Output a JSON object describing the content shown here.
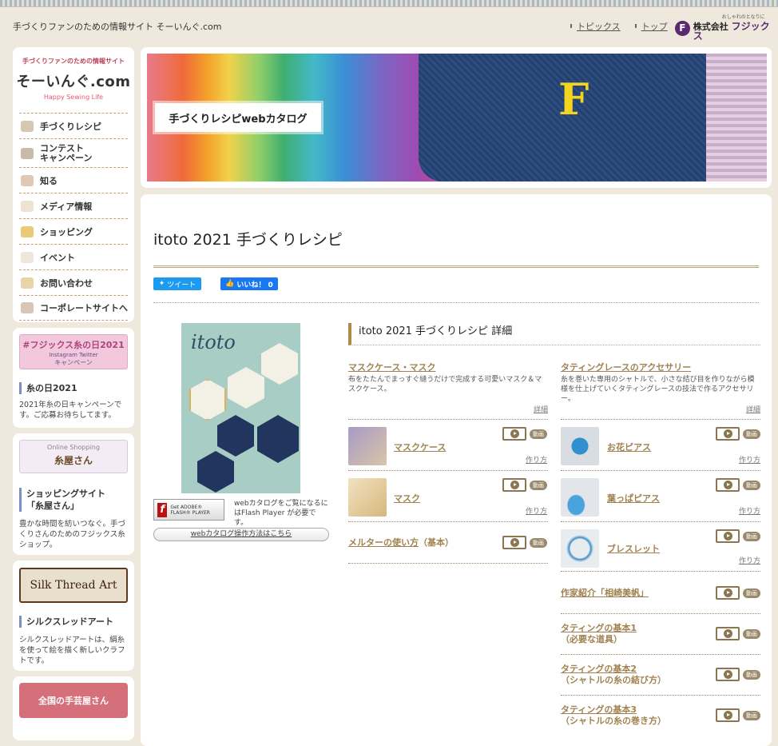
{
  "header": {
    "site_tagline": "手づくりファンのための情報サイト そーいんぐ.com",
    "links": [
      "トピックス",
      "トップ"
    ],
    "company_sub": "おしゃれのとなりに",
    "company_prefix": "株式会社",
    "company_name": "フジックス",
    "company_mark": "F"
  },
  "sidebar": {
    "logo_tag": "手づくりファンのための情報サイト",
    "logo_main": "そーいんぐ.com",
    "logo_eng": "Happy Sewing Life",
    "nav": [
      {
        "label": "手づくりレシピ",
        "icon": "needle-icon"
      },
      {
        "label": "コンテスト\nキャンペーン",
        "icon": "sewing-machine-icon"
      },
      {
        "label": "知る",
        "icon": "book-icon"
      },
      {
        "label": "メディア情報",
        "icon": "shirt-icon"
      },
      {
        "label": "ショッピング",
        "icon": "basket-icon"
      },
      {
        "label": "イベント",
        "icon": "cloud-icon"
      },
      {
        "label": "お問い合わせ",
        "icon": "mail-icon"
      },
      {
        "label": "コーポレートサイトへ",
        "icon": "building-icon"
      }
    ],
    "promo1": {
      "banner_title": "#フジックス糸の日2021",
      "banner_sub": "Instagram  Twitter",
      "banner_sub2": "キャンペーン",
      "title": "糸の日2021",
      "text": "2021年糸の日キャンペーンです。ご応募お待ちしてます。"
    },
    "promo2": {
      "banner_title": "Online Shopping",
      "banner_name": "糸屋さん",
      "title": "ショッピングサイト\n「糸屋さん」",
      "text": "豊かな時間を紡いつなぐ。手づくりさんのためのフジックス糸ショップ。"
    },
    "promo3": {
      "banner_title": "Silk Thread Art",
      "title": "シルクスレッドアート",
      "text": "シルクスレッドアートは、絹糸を使って絵を描く新しいクラフトです。"
    },
    "promo4": {
      "banner_title": "全国の手芸屋さん"
    }
  },
  "hero": {
    "label": "手づくりレシピwebカタログ",
    "letter": "F"
  },
  "main": {
    "title": "itoto 2021 手づくりレシピ",
    "tweet": "ツイート",
    "like": "いいね！ 0",
    "catalog_title": "itoto",
    "flash_badge": "Get ADOBE® FLASH® PLAYER",
    "flash_note": "webカタログをご覧になるにはFlash Player が必要です。",
    "howto_link": "webカタログ操作方法はこちら",
    "detail_heading": "itoto 2021 手づくりレシピ 詳細"
  },
  "left_col": {
    "title": "マスクケース・マスク",
    "desc": "布をたたんでまっすぐ縫うだけで完成する可愛いマスク＆マスクケース。",
    "detail": "詳細",
    "items": [
      {
        "name": "マスクケース",
        "howto": "作り方"
      },
      {
        "name": "マスク",
        "howto": "作り方"
      }
    ],
    "melter": "メルターの使い方",
    "melter_sub": "（基本）"
  },
  "right_col": {
    "title": "タティングレースのアクセサリー",
    "desc": "糸を巻いた専用のシャトルで、小さな結び目を作りながら模様を仕上げていくタティングレースの技法で作るアクセサリー。",
    "detail": "詳細",
    "items": [
      {
        "name": "お花ピアス",
        "howto": "作り方"
      },
      {
        "name": "葉っぱピアス",
        "howto": "作り方"
      },
      {
        "name": "ブレスレット",
        "howto": "作り方"
      }
    ],
    "extra": [
      {
        "line1": "作家紹介「相崎美帆」",
        "line2": ""
      },
      {
        "line1": "タティングの基本1",
        "line2": "（必要な道具）"
      },
      {
        "line1": "タティングの基本2",
        "line2": "（シャトルの糸の結び方）"
      },
      {
        "line1": "タティングの基本3",
        "line2": "（シャトルの糸の巻き方）"
      }
    ]
  },
  "video_label": "動画"
}
